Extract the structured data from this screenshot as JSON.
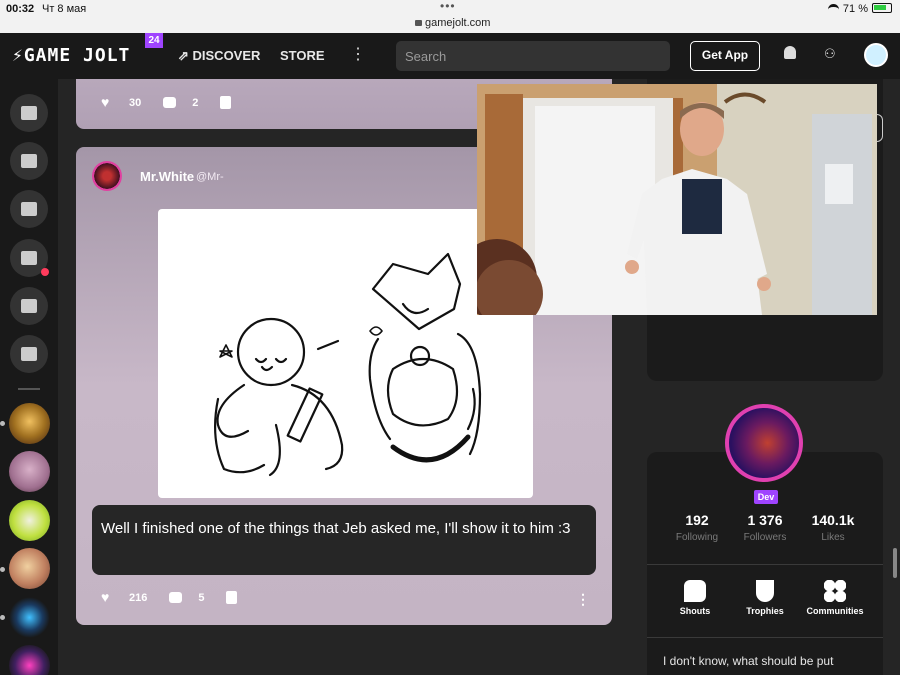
{
  "status_bar": {
    "time": "00:32",
    "date": "Чт 8 мая",
    "url": "gamejolt.com",
    "battery": "71 %"
  },
  "nav": {
    "logo": "GAME JOLT",
    "badge": "24",
    "discover": "DISCOVER",
    "store": "STORE",
    "search_placeholder": "Search",
    "get_app": "Get App"
  },
  "feed": {
    "prev_post": {
      "likes": "30",
      "comments": "2"
    },
    "post": {
      "author": "Mr.White",
      "handle": "@Mr-",
      "text": "Well I finished one of the things that Jeb asked me, I'll show it to him :3",
      "likes": "216",
      "comments": "5"
    }
  },
  "profile": {
    "badge": "Dev",
    "stats": [
      {
        "value": "192",
        "label": "Following"
      },
      {
        "value": "1 376",
        "label": "Followers"
      },
      {
        "value": "140.1k",
        "label": "Likes"
      }
    ],
    "buttons": [
      {
        "label": "Shouts"
      },
      {
        "label": "Trophies"
      },
      {
        "label": "Communities"
      }
    ],
    "bio": "I don't know, what should be put"
  },
  "colors": {
    "accent": "#9f44ff",
    "nav_bg": "#191919",
    "page_bg": "#252525",
    "card_bg": "#b8a8bb"
  }
}
